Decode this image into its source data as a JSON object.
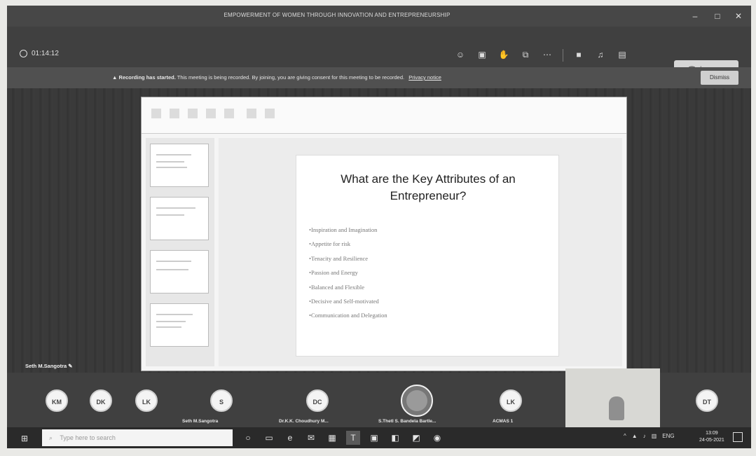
{
  "window": {
    "title": "EMPOWERMENT OF WOMEN THROUGH INNOVATION AND ENTREPRENEURSHIP",
    "controls": [
      "–",
      "□",
      "✕"
    ]
  },
  "meeting": {
    "timer": "01:14:12",
    "leave_label": "Leave",
    "toolbar_icons": [
      "people-icon",
      "chat-icon",
      "raise-hand-icon",
      "breakout-icon",
      "more-icon",
      "camera-icon",
      "mic-icon",
      "share-icon"
    ]
  },
  "banner": {
    "title": "Recording has started.",
    "text": "This meeting is being recorded. By joining, you are giving consent for this meeting to be recorded.",
    "privacy_link": "Privacy notice",
    "dismiss_label": "Dismiss"
  },
  "presenter": {
    "name": "Seth M.Sangotra"
  },
  "slide": {
    "title": "What are the Key Attributes of an Entrepreneur?",
    "bullets": [
      "Inspiration and Imagination",
      "Appetite for risk",
      "Tenacity and Resilience",
      "Passion and Energy",
      "Balanced and Flexible",
      "Decisive and Self-motivated",
      "Communication and Delegation"
    ]
  },
  "participants": [
    {
      "initials": "KM"
    },
    {
      "initials": "DK"
    },
    {
      "initials": "LK"
    },
    {
      "initials": "S",
      "name": "Seth M.Sangotra"
    },
    {
      "initials": "DC",
      "name": "Dr.K.K. Choudhury M..."
    },
    {
      "initials": "",
      "name": "S.Thetl S. Bandela Bartle..."
    },
    {
      "initials": "LK",
      "name": "ACMAS 1"
    },
    {
      "initials": "DT"
    }
  ],
  "taskbar": {
    "search_placeholder": "Type here to search",
    "time": "13:09",
    "date": "24-05-2021",
    "tray_lang": "ENG"
  }
}
